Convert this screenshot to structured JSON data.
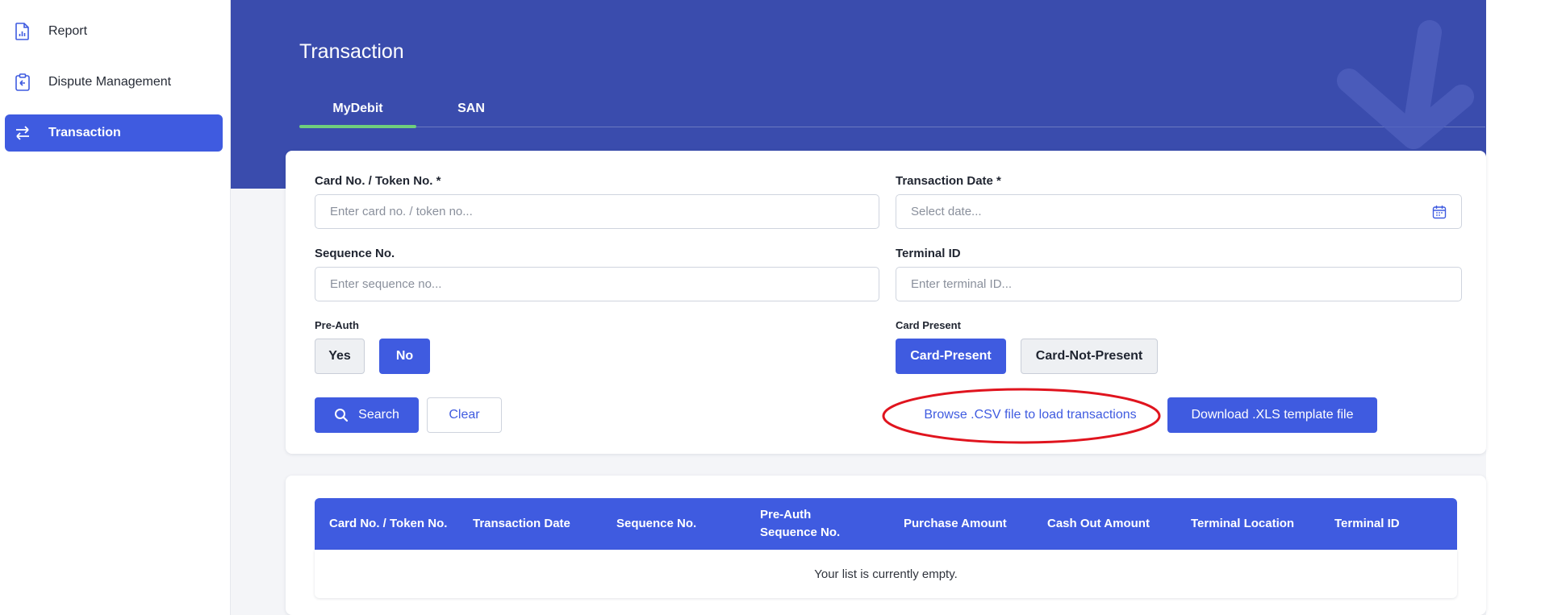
{
  "sidebar": {
    "items": [
      {
        "label": "Report",
        "icon": "report-icon"
      },
      {
        "label": "Dispute Management",
        "icon": "clipboard-icon"
      },
      {
        "label": "Transaction",
        "icon": "swap-arrows-icon",
        "active": true
      }
    ]
  },
  "header": {
    "title": "Transaction",
    "tabs": [
      {
        "label": "MyDebit",
        "active": true
      },
      {
        "label": "SAN",
        "active": false
      }
    ]
  },
  "form": {
    "card_no_label": "Card No. / Token No. *",
    "card_no_placeholder": "Enter card no. / token no...",
    "txn_date_label": "Transaction Date *",
    "txn_date_placeholder": "Select date...",
    "sequence_label": "Sequence No.",
    "sequence_placeholder": "Enter sequence no...",
    "terminal_label": "Terminal ID",
    "terminal_placeholder": "Enter terminal ID...",
    "preauth_label": "Pre-Auth",
    "preauth_yes": "Yes",
    "preauth_no": "No",
    "preauth_selected": "No",
    "card_present_label": "Card Present",
    "card_present_option": "Card-Present",
    "card_not_present_option": "Card-Not-Present",
    "card_present_selected": "Card-Present",
    "search_label": "Search",
    "clear_label": "Clear",
    "browse_label": "Browse .CSV file to load transactions",
    "download_label": "Download .XLS template file"
  },
  "table": {
    "columns": [
      "Card No. / Token No.",
      "Transaction Date",
      "Sequence No.",
      "Pre-Auth Sequence No.",
      "Purchase Amount",
      "Cash Out Amount",
      "Terminal Location",
      "Terminal ID"
    ],
    "empty_message": "Your list is currently empty."
  },
  "colors": {
    "primary": "#3f5be0",
    "banner": "#3a4cad",
    "tab_indicator": "#6fcf7c",
    "annotation": "#e0141e"
  }
}
